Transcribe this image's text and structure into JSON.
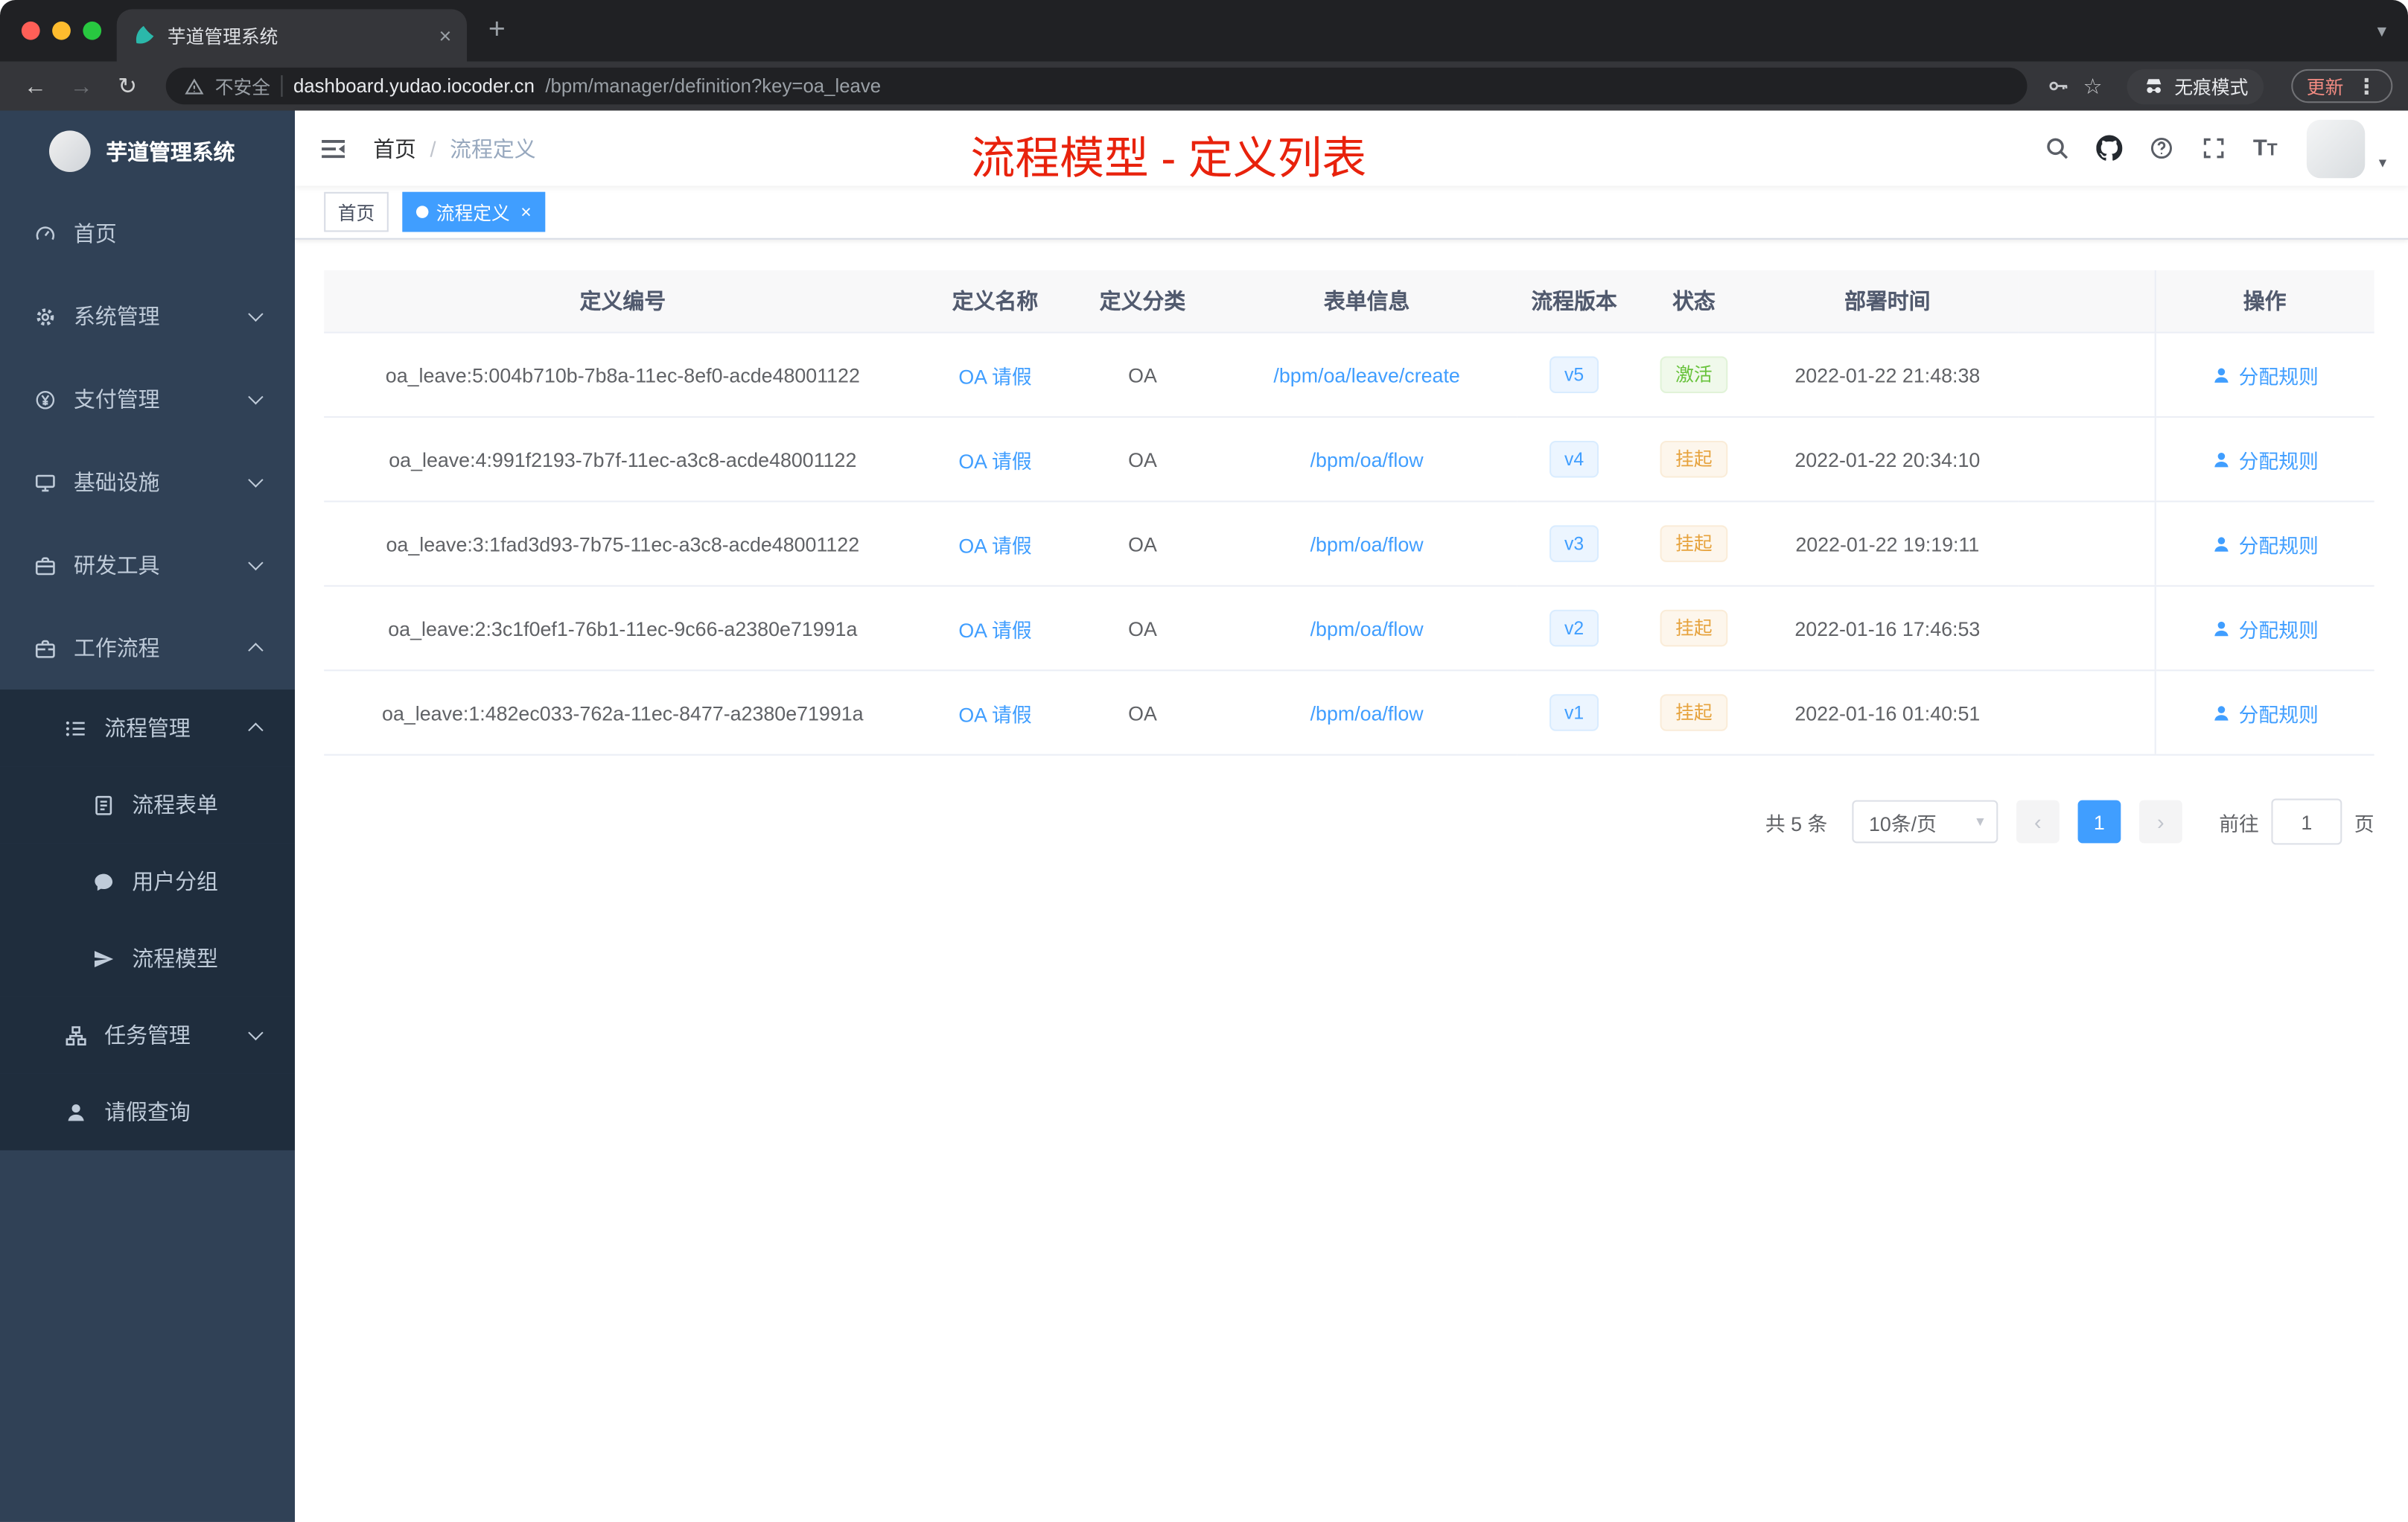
{
  "colors": {
    "primary": "#409eff",
    "annotation_red": "#e8220c",
    "sidebar_bg": "#304156",
    "submenu_bg": "#1f2d3d",
    "status_active_green": "#67c23a",
    "status_suspended_orange": "#e6a23c",
    "version_tag_blue": "#409eff"
  },
  "browser": {
    "tab_title": "芋道管理系统",
    "address": {
      "security_label": "不安全",
      "domain": "dashboard.yudao.iocoder.cn",
      "path": "/bpm/manager/definition?key=oa_leave"
    },
    "incognito_label": "无痕模式",
    "update_label": "更新"
  },
  "sidebar": {
    "logo_text": "芋道管理系统",
    "items": [
      {
        "name": "home",
        "label": "首页",
        "icon": "dashboard-icon",
        "level": 1,
        "chevron": ""
      },
      {
        "name": "system-management",
        "label": "系统管理",
        "icon": "gear-icon",
        "level": 1,
        "chevron": "down"
      },
      {
        "name": "payment-management",
        "label": "支付管理",
        "icon": "payment-icon",
        "level": 1,
        "chevron": "down"
      },
      {
        "name": "infrastructure",
        "label": "基础设施",
        "icon": "infrastructure-icon",
        "level": 1,
        "chevron": "down"
      },
      {
        "name": "dev-tools",
        "label": "研发工具",
        "icon": "devtools-icon",
        "level": 1,
        "chevron": "down"
      },
      {
        "name": "workflow",
        "label": "工作流程",
        "icon": "workflow-icon",
        "level": 1,
        "chevron": "up"
      },
      {
        "name": "process-management",
        "label": "流程管理",
        "icon": "process-list-icon",
        "level": 2,
        "chevron": "up"
      },
      {
        "name": "process-form",
        "label": "流程表单",
        "icon": "form-icon",
        "level": 3,
        "chevron": ""
      },
      {
        "name": "user-group",
        "label": "用户分组",
        "icon": "user-group-icon",
        "level": 3,
        "chevron": ""
      },
      {
        "name": "process-model",
        "label": "流程模型",
        "icon": "send-icon",
        "level": 3,
        "chevron": ""
      },
      {
        "name": "task-management",
        "label": "任务管理",
        "icon": "org-icon",
        "level": 2,
        "chevron": "down"
      },
      {
        "name": "leave-query",
        "label": "请假查询",
        "icon": "person-icon",
        "level": 2,
        "chevron": ""
      }
    ]
  },
  "navbar": {
    "breadcrumb": [
      "首页",
      "流程定义"
    ],
    "annotation": "流程模型 - 定义列表",
    "icons": [
      "search-icon",
      "github-icon",
      "help-icon",
      "fullscreen-icon",
      "font-size-icon",
      "hamburger-icon",
      "avatar"
    ]
  },
  "tags": [
    {
      "label": "首页",
      "active": false
    },
    {
      "label": "流程定义",
      "active": true
    }
  ],
  "table": {
    "columns": [
      "定义编号",
      "定义名称",
      "定义分类",
      "表单信息",
      "流程版本",
      "状态",
      "部署时间",
      "操作"
    ],
    "rows": [
      {
        "id": "oa_leave:5:004b710b-7b8a-11ec-8ef0-acde48001122",
        "name": "OA 请假",
        "category": "OA",
        "form": "/bpm/oa/leave/create",
        "version": "v5",
        "status": "激活",
        "status_type": "success",
        "deploy_time": "2022-01-22 21:48:38",
        "action": "分配规则"
      },
      {
        "id": "oa_leave:4:991f2193-7b7f-11ec-a3c8-acde48001122",
        "name": "OA 请假",
        "category": "OA",
        "form": "/bpm/oa/flow",
        "version": "v4",
        "status": "挂起",
        "status_type": "warning",
        "deploy_time": "2022-01-22 20:34:10",
        "action": "分配规则"
      },
      {
        "id": "oa_leave:3:1fad3d93-7b75-11ec-a3c8-acde48001122",
        "name": "OA 请假",
        "category": "OA",
        "form": "/bpm/oa/flow",
        "version": "v3",
        "status": "挂起",
        "status_type": "warning",
        "deploy_time": "2022-01-22 19:19:11",
        "action": "分配规则"
      },
      {
        "id": "oa_leave:2:3c1f0ef1-76b1-11ec-9c66-a2380e71991a",
        "name": "OA 请假",
        "category": "OA",
        "form": "/bpm/oa/flow",
        "version": "v2",
        "status": "挂起",
        "status_type": "warning",
        "deploy_time": "2022-01-16 17:46:53",
        "action": "分配规则"
      },
      {
        "id": "oa_leave:1:482ec033-762a-11ec-8477-a2380e71991a",
        "name": "OA 请假",
        "category": "OA",
        "form": "/bpm/oa/flow",
        "version": "v1",
        "status": "挂起",
        "status_type": "warning",
        "deploy_time": "2022-01-16 01:40:51",
        "action": "分配规则"
      }
    ]
  },
  "pagination": {
    "total_label": "共 5 条",
    "page_size": "10条/页",
    "prev_label": "‹",
    "next_label": "›",
    "current_page": "1",
    "goto_label": "前往",
    "goto_value": "1",
    "page_unit": "页"
  }
}
